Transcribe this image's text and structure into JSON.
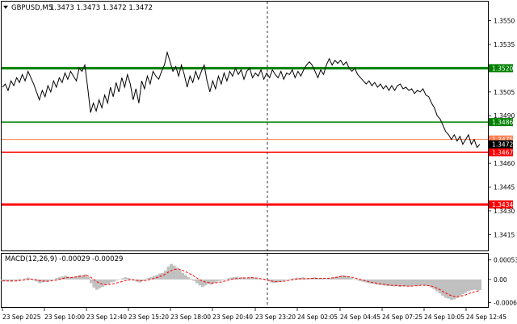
{
  "header": {
    "symbol_label": "GBPUSD,M5",
    "ohlc_label": "1.3473 1.3473 1.3472 1.3472"
  },
  "colors": {
    "background": "#ffffff",
    "price_line": "#000000",
    "support_resistance": "#008000",
    "key_level": "#ff0000",
    "bid_line": "#ff7f50",
    "macd_histogram": "#c0c0c0",
    "macd_signal": "#ff0000",
    "grid_separator": "#000000"
  },
  "chart_data": [
    {
      "type": "line",
      "title": "GBPUSD,M5",
      "ylim": [
        1.3405,
        1.3562
      ],
      "y_ticks": [
        "1.3550",
        "1.3535",
        "1.3505",
        "1.3490",
        "1.3460",
        "1.3445",
        "1.3430",
        "1.3415"
      ],
      "x_ticks": [
        "23 Sep 2025",
        "23 Sep 10:00",
        "23 Sep 12:40",
        "23 Sep 15:20",
        "23 Sep 18:00",
        "23 Sep 20:40",
        "23 Sep 23:20",
        "24 Sep 02:05",
        "24 Sep 04:45",
        "24 Sep 07:25",
        "24 Sep 10:05",
        "24 Sep 12:45"
      ],
      "levels": [
        {
          "value": 1.352,
          "label": "1.3520",
          "color": "#008000",
          "width": 3
        },
        {
          "value": 1.3486,
          "label": "1.3486",
          "color": "#008000",
          "width": 1.5
        },
        {
          "value": 1.3475,
          "label": "1.3475",
          "color": "#ff7f50",
          "width": 1
        },
        {
          "value": 1.3467,
          "label": "1.3467",
          "color": "#ff0000",
          "width": 1.5
        },
        {
          "value": 1.3434,
          "label": "1.3434",
          "color": "#ff0000",
          "width": 3
        }
      ],
      "current_price": {
        "value": 1.3472,
        "label": "1.3472"
      },
      "series": [
        {
          "values": [
            1.3508,
            1.351,
            1.3506,
            1.3512,
            1.3509,
            1.3514,
            1.3511,
            1.3516,
            1.3512,
            1.3518,
            1.3514,
            1.351,
            1.3505,
            1.35,
            1.3506,
            1.3502,
            1.3509,
            1.3505,
            1.3512,
            1.3508,
            1.3514,
            1.3511,
            1.3517,
            1.3513,
            1.3518,
            1.3515,
            1.3512,
            1.352,
            1.3518,
            1.3522,
            1.3508,
            1.3492,
            1.3498,
            1.3493,
            1.35,
            1.3495,
            1.3503,
            1.3498,
            1.3508,
            1.3502,
            1.3511,
            1.3505,
            1.3514,
            1.3508,
            1.3516,
            1.351,
            1.35,
            1.3507,
            1.3498,
            1.3512,
            1.3507,
            1.3515,
            1.351,
            1.3518,
            1.3515,
            1.3513,
            1.3518,
            1.3522,
            1.353,
            1.3524,
            1.3518,
            1.3521,
            1.3515,
            1.3522,
            1.3516,
            1.3508,
            1.3515,
            1.3511,
            1.3518,
            1.3513,
            1.3518,
            1.3522,
            1.3512,
            1.3505,
            1.3512,
            1.3507,
            1.3515,
            1.351,
            1.3517,
            1.3512,
            1.3518,
            1.3515,
            1.352,
            1.3516,
            1.3519,
            1.3513,
            1.3518,
            1.352,
            1.3514,
            1.3517,
            1.3515,
            1.3519,
            1.3513,
            1.3517,
            1.3514,
            1.3519,
            1.3516,
            1.3514,
            1.3518,
            1.3513,
            1.3517,
            1.3516,
            1.3519,
            1.3514,
            1.3518,
            1.3515,
            1.3519,
            1.3522,
            1.3524,
            1.3522,
            1.3518,
            1.3514,
            1.3519,
            1.3516,
            1.3522,
            1.3526,
            1.3522,
            1.3525,
            1.3523,
            1.3525,
            1.3522,
            1.3524,
            1.352,
            1.3518,
            1.352,
            1.3516,
            1.3514,
            1.3512,
            1.351,
            1.3512,
            1.3509,
            1.3511,
            1.3508,
            1.351,
            1.3507,
            1.3509,
            1.3506,
            1.3509,
            1.3506,
            1.3509,
            1.351,
            1.3507,
            1.3508,
            1.3506,
            1.3507,
            1.3504,
            1.3506,
            1.3505,
            1.3507,
            1.3503,
            1.3502,
            1.3498,
            1.3495,
            1.349,
            1.3488,
            1.3484,
            1.348,
            1.3478,
            1.3475,
            1.3478,
            1.3474,
            1.3477,
            1.3472,
            1.3475,
            1.3478,
            1.3472,
            1.3475,
            1.347,
            1.3472
          ],
          "color": "#000000"
        }
      ]
    },
    {
      "type": "line",
      "title": "MACD(12,26,9) -0.00029 -0.00029",
      "ylim": [
        -0.00075,
        0.0007
      ],
      "y_ticks": [
        "0.00053",
        "0.00",
        "-0.00063"
      ],
      "histogram": [
        -4e-05,
        -5e-05,
        -3e-05,
        -6e-05,
        -2e-05,
        -4e-05,
        2e-05,
        -1e-05,
        3e-05,
        5e-05,
        2e-05,
        -3e-05,
        -6e-05,
        -0.0001,
        -8e-05,
        -6e-05,
        -4e-05,
        -2e-05,
        1e-05,
        4e-05,
        6e-05,
        8e-05,
        0.0001,
        8e-05,
        5e-05,
        7e-05,
        9e-05,
        0.00012,
        0.0001,
        0.00014,
        6e-05,
        -0.0001,
        -0.00022,
        -0.00028,
        -0.00024,
        -0.0002,
        -0.00016,
        -0.00012,
        -8e-05,
        -6e-05,
        -2e-05,
        0.0,
        3e-05,
        6e-05,
        4e-05,
        2e-05,
        -3e-05,
        -6e-05,
        -8e-05,
        -4e-05,
        1e-05,
        4e-05,
        6e-05,
        9e-05,
        0.00012,
        0.00016,
        0.00018,
        0.00024,
        0.00035,
        0.00042,
        0.00038,
        0.00032,
        0.00026,
        0.00018,
        0.00012,
        6e-05,
        2e-05,
        -4e-05,
        -0.0001,
        -0.00016,
        -0.0002,
        -0.00016,
        -0.00012,
        -0.00014,
        -0.0001,
        -6e-05,
        -4e-05,
        -2e-05,
        1e-05,
        3e-05,
        5e-05,
        6e-05,
        7e-05,
        4e-05,
        6e-05,
        3e-05,
        5e-05,
        7e-05,
        4e-05,
        2e-05,
        1e-05,
        0.0,
        -2e-05,
        -5e-05,
        -8e-05,
        -0.0001,
        -8e-05,
        -6e-05,
        -4e-05,
        -2e-05,
        0.0,
        2e-05,
        3e-05,
        5e-05,
        4e-05,
        6e-05,
        3e-05,
        2e-05,
        4e-05,
        6e-05,
        4e-05,
        2e-05,
        3e-05,
        1e-05,
        2e-05,
        4e-05,
        6e-05,
        8e-05,
        0.0001,
        0.00012,
        0.0001,
        8e-05,
        4e-05,
        1e-05,
        -2e-05,
        -4e-05,
        -6e-05,
        -8e-05,
        -0.0001,
        -0.00011,
        -0.00012,
        -0.00014,
        -0.00015,
        -0.00016,
        -0.00017,
        -0.00018,
        -0.00018,
        -0.00019,
        -0.00018,
        -0.0002,
        -0.00019,
        -0.00018,
        -0.00019,
        -0.00018,
        -0.00017,
        -0.00018,
        -0.00016,
        -0.00015,
        -0.00016,
        -0.00018,
        -0.00022,
        -0.00026,
        -0.00032,
        -0.00038,
        -0.00044,
        -0.0005,
        -0.00052,
        -0.00056,
        -0.00054,
        -0.0005,
        -0.00045,
        -0.0004,
        -0.00036,
        -0.00032,
        -0.0003,
        -0.00028,
        -0.00029,
        -0.00029
      ],
      "signal": [
        -4e-05,
        -4e-05,
        -4e-05,
        -4e-05,
        -4e-05,
        -4e-05,
        -3e-05,
        -2e-05,
        -1e-05,
        0.0,
        1e-05,
        0.0,
        -1e-05,
        -3e-05,
        -4e-05,
        -5e-05,
        -5e-05,
        -4e-05,
        -3e-05,
        -2e-05,
        0.0,
        2e-05,
        4e-05,
        5e-05,
        5e-05,
        6e-05,
        7e-05,
        8e-05,
        9e-05,
        0.0001,
        0.0001,
        6e-05,
        1e-05,
        -5e-05,
        -9e-05,
        -0.00012,
        -0.00014,
        -0.00014,
        -0.00013,
        -0.00012,
        -0.0001,
        -8e-05,
        -6e-05,
        -4e-05,
        -2e-05,
        -1e-05,
        -1e-05,
        -2e-05,
        -3e-05,
        -4e-05,
        -3e-05,
        -2e-05,
        0.0,
        2e-05,
        4e-05,
        7e-05,
        0.0001,
        0.00013,
        0.00018,
        0.00023,
        0.00026,
        0.00028,
        0.00028,
        0.00026,
        0.00023,
        0.00019,
        0.00015,
        0.00011,
        6e-05,
        1e-05,
        -3e-05,
        -6e-05,
        -8e-05,
        -9e-05,
        -0.0001,
        -9e-05,
        -8e-05,
        -7e-05,
        -5e-05,
        -3e-05,
        -1e-05,
        1e-05,
        2e-05,
        3e-05,
        4e-05,
        4e-05,
        4e-05,
        5e-05,
        5e-05,
        4e-05,
        3e-05,
        2e-05,
        1e-05,
        -1e-05,
        -3e-05,
        -5e-05,
        -6e-05,
        -6e-05,
        -6e-05,
        -5e-05,
        -4e-05,
        -2e-05,
        -1e-05,
        0.0,
        1e-05,
        2e-05,
        2e-05,
        2e-05,
        3e-05,
        3e-05,
        3e-05,
        3e-05,
        3e-05,
        3e-05,
        3e-05,
        3e-05,
        4e-05,
        5e-05,
        6e-05,
        8e-05,
        8e-05,
        8e-05,
        7e-05,
        6e-05,
        4e-05,
        2e-05,
        0.0,
        -2e-05,
        -4e-05,
        -6e-05,
        -8e-05,
        -9e-05,
        -0.00011,
        -0.00012,
        -0.00013,
        -0.00014,
        -0.00015,
        -0.00016,
        -0.00016,
        -0.00017,
        -0.00017,
        -0.00017,
        -0.00018,
        -0.00018,
        -0.00018,
        -0.00017,
        -0.00017,
        -0.00016,
        -0.00016,
        -0.00016,
        -0.00017,
        -0.00018,
        -0.00021,
        -0.00024,
        -0.00028,
        -0.00033,
        -0.00037,
        -0.00041,
        -0.00044,
        -0.00046,
        -0.00047,
        -0.00046,
        -0.00044,
        -0.00042,
        -0.00039,
        -0.00036,
        -0.00034,
        -0.00032,
        -0.0003
      ]
    }
  ]
}
